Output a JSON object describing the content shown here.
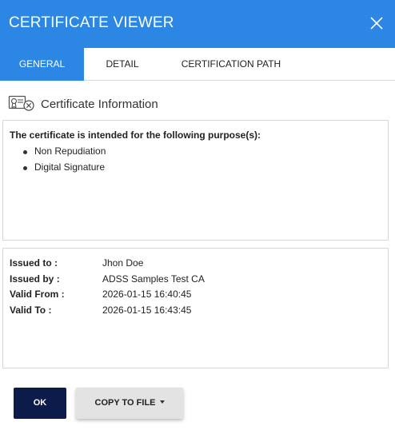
{
  "dialog": {
    "title": "CERTIFICATE VIEWER",
    "close_icon": "close-icon",
    "accent_color": "#2b87e3"
  },
  "tabs": [
    {
      "label": "GENERAL",
      "active": true
    },
    {
      "label": "DETAIL",
      "active": false
    },
    {
      "label": "CERTIFICATION PATH",
      "active": false
    }
  ],
  "section": {
    "icon": "certificate-icon",
    "label": "Certificate Information"
  },
  "purpose": {
    "heading": "The certificate is intended for the following purpose(s):",
    "items": [
      "Non Repudiation",
      "Digital Signature"
    ]
  },
  "details": [
    {
      "key": "Issued to :",
      "value": "Jhon Doe"
    },
    {
      "key": "Issued by :",
      "value": "ADSS Samples Test CA"
    },
    {
      "key": "Valid From :",
      "value": "2026-01-15 16:40:45"
    },
    {
      "key": "Valid To :",
      "value": "2026-01-15 16:43:45"
    }
  ],
  "buttons": {
    "ok_label": "OK",
    "copy_label": "COPY TO FILE",
    "ok_color": "#0d1b4a"
  }
}
